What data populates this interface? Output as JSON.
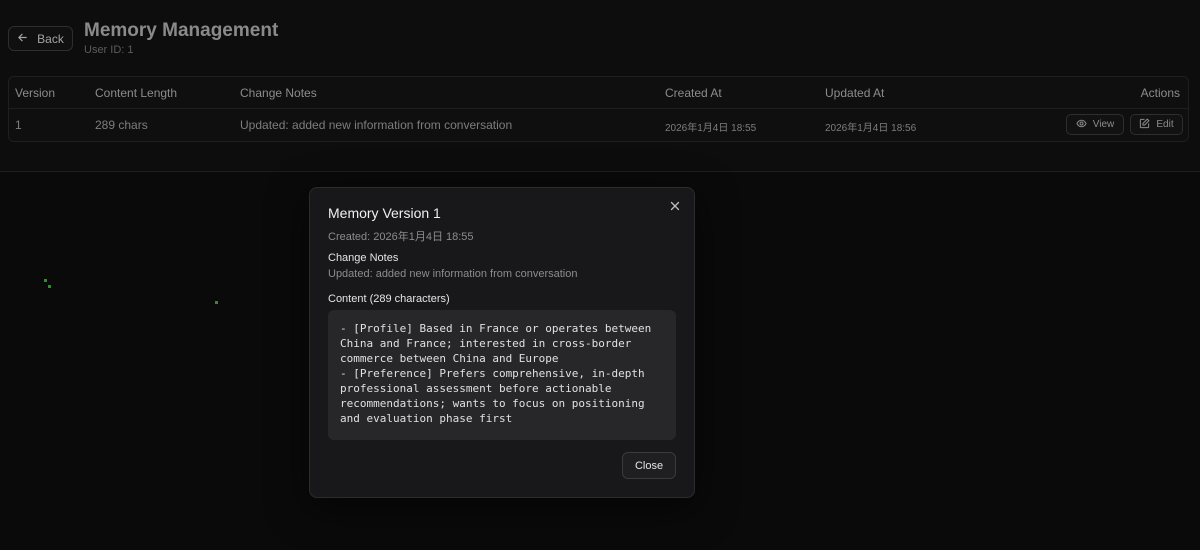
{
  "header": {
    "back_label": "Back",
    "title": "Memory Management",
    "user_id": "User ID: 1"
  },
  "table": {
    "columns": [
      "Version",
      "Content Length",
      "Change Notes",
      "Created At",
      "Updated At",
      "Actions"
    ],
    "rows": [
      {
        "version": "1",
        "content_length": "289 chars",
        "change_notes": "Updated: added new information from conversation",
        "created_at": "2026年1月4日 18:55",
        "updated_at": "2026年1月4日 18:56",
        "view_label": "View",
        "edit_label": "Edit"
      }
    ]
  },
  "modal": {
    "title": "Memory Version 1",
    "created": "Created: 2026年1月4日 18:55",
    "change_notes_label": "Change Notes",
    "change_notes": "Updated: added new information from conversation",
    "content_label": "Content (289 characters)",
    "content": "- [Profile] Based in France or operates between China and France; interested in cross-border commerce between China and Europe\n- [Preference] Prefers comprehensive, in-depth professional assessment before actionable recommendations; wants to focus on positioning and evaluation phase first",
    "close_label": "Close"
  },
  "icons": {
    "back": "arrow-left-icon",
    "view": "eye-icon",
    "edit": "edit-icon",
    "close": "close-icon"
  }
}
